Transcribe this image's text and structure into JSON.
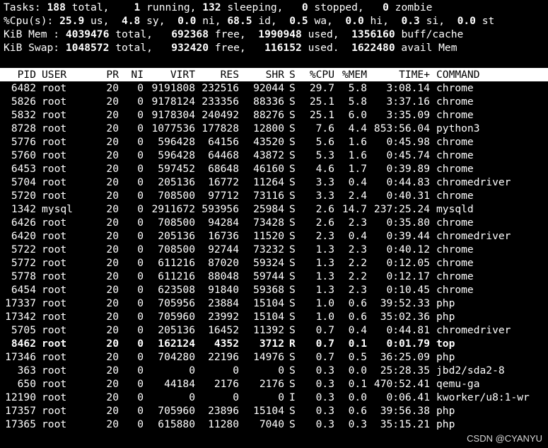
{
  "summary": {
    "tasks": {
      "label": "Tasks:",
      "total": "188",
      "total_label": "total,",
      "running": "1",
      "running_label": "running,",
      "sleeping": "132",
      "sleeping_label": "sleeping,",
      "stopped": "0",
      "stopped_label": "stopped,",
      "zombie": "0",
      "zombie_label": "zombie"
    },
    "cpu": {
      "label": "%Cpu(s):",
      "us": "25.9",
      "us_label": "us,",
      "sy": "4.8",
      "sy_label": "sy,",
      "ni": "0.0",
      "ni_label": "ni,",
      "id": "68.5",
      "id_label": "id,",
      "wa": "0.5",
      "wa_label": "wa,",
      "hi": "0.0",
      "hi_label": "hi,",
      "si": "0.3",
      "si_label": "si,",
      "st": "0.0",
      "st_label": "st"
    },
    "mem": {
      "label": "KiB Mem :",
      "total": "4039476",
      "total_label": "total,",
      "free": "692368",
      "free_label": "free,",
      "used": "1990948",
      "used_label": "used,",
      "buff": "1356160",
      "buff_label": "buff/cache"
    },
    "swap": {
      "label": "KiB Swap:",
      "total": "1048572",
      "total_label": "total,",
      "free": "932420",
      "free_label": "free,",
      "used": "116152",
      "used_label": "used.",
      "avail": "1622480",
      "avail_label": "avail Mem"
    }
  },
  "columns": [
    "PID",
    "USER",
    "PR",
    "NI",
    "VIRT",
    "RES",
    "SHR",
    "S",
    "%CPU",
    "%MEM",
    "TIME+",
    "COMMAND"
  ],
  "processes": [
    {
      "pid": "6482",
      "user": "root",
      "pr": "20",
      "ni": "0",
      "virt": "9191808",
      "res": "232516",
      "shr": "92044",
      "s": "S",
      "cpu": "29.7",
      "mem": "5.8",
      "time": "3:08.14",
      "cmd": "chrome"
    },
    {
      "pid": "5826",
      "user": "root",
      "pr": "20",
      "ni": "0",
      "virt": "9178124",
      "res": "233356",
      "shr": "88336",
      "s": "S",
      "cpu": "25.1",
      "mem": "5.8",
      "time": "3:37.16",
      "cmd": "chrome"
    },
    {
      "pid": "5832",
      "user": "root",
      "pr": "20",
      "ni": "0",
      "virt": "9178304",
      "res": "240492",
      "shr": "88276",
      "s": "S",
      "cpu": "25.1",
      "mem": "6.0",
      "time": "3:35.09",
      "cmd": "chrome"
    },
    {
      "pid": "8728",
      "user": "root",
      "pr": "20",
      "ni": "0",
      "virt": "1077536",
      "res": "177828",
      "shr": "12800",
      "s": "S",
      "cpu": "7.6",
      "mem": "4.4",
      "time": "853:56.04",
      "cmd": "python3"
    },
    {
      "pid": "5776",
      "user": "root",
      "pr": "20",
      "ni": "0",
      "virt": "596428",
      "res": "64156",
      "shr": "43520",
      "s": "S",
      "cpu": "5.6",
      "mem": "1.6",
      "time": "0:45.98",
      "cmd": "chrome"
    },
    {
      "pid": "5760",
      "user": "root",
      "pr": "20",
      "ni": "0",
      "virt": "596428",
      "res": "64468",
      "shr": "43872",
      "s": "S",
      "cpu": "5.3",
      "mem": "1.6",
      "time": "0:45.74",
      "cmd": "chrome"
    },
    {
      "pid": "6453",
      "user": "root",
      "pr": "20",
      "ni": "0",
      "virt": "597452",
      "res": "68648",
      "shr": "46160",
      "s": "S",
      "cpu": "4.6",
      "mem": "1.7",
      "time": "0:39.89",
      "cmd": "chrome"
    },
    {
      "pid": "5704",
      "user": "root",
      "pr": "20",
      "ni": "0",
      "virt": "205136",
      "res": "16772",
      "shr": "11264",
      "s": "S",
      "cpu": "3.3",
      "mem": "0.4",
      "time": "0:44.83",
      "cmd": "chromedriver"
    },
    {
      "pid": "5720",
      "user": "root",
      "pr": "20",
      "ni": "0",
      "virt": "708500",
      "res": "97712",
      "shr": "73116",
      "s": "S",
      "cpu": "3.3",
      "mem": "2.4",
      "time": "0:40.31",
      "cmd": "chrome"
    },
    {
      "pid": "1342",
      "user": "mysql",
      "pr": "20",
      "ni": "0",
      "virt": "2911672",
      "res": "593956",
      "shr": "25984",
      "s": "S",
      "cpu": "2.6",
      "mem": "14.7",
      "time": "237:25.24",
      "cmd": "mysqld"
    },
    {
      "pid": "6426",
      "user": "root",
      "pr": "20",
      "ni": "0",
      "virt": "708500",
      "res": "94284",
      "shr": "73428",
      "s": "S",
      "cpu": "2.6",
      "mem": "2.3",
      "time": "0:35.80",
      "cmd": "chrome"
    },
    {
      "pid": "6420",
      "user": "root",
      "pr": "20",
      "ni": "0",
      "virt": "205136",
      "res": "16736",
      "shr": "11520",
      "s": "S",
      "cpu": "2.3",
      "mem": "0.4",
      "time": "0:39.44",
      "cmd": "chromedriver"
    },
    {
      "pid": "5722",
      "user": "root",
      "pr": "20",
      "ni": "0",
      "virt": "708500",
      "res": "92744",
      "shr": "73232",
      "s": "S",
      "cpu": "1.3",
      "mem": "2.3",
      "time": "0:40.12",
      "cmd": "chrome"
    },
    {
      "pid": "5772",
      "user": "root",
      "pr": "20",
      "ni": "0",
      "virt": "611216",
      "res": "87020",
      "shr": "59324",
      "s": "S",
      "cpu": "1.3",
      "mem": "2.2",
      "time": "0:12.05",
      "cmd": "chrome"
    },
    {
      "pid": "5778",
      "user": "root",
      "pr": "20",
      "ni": "0",
      "virt": "611216",
      "res": "88048",
      "shr": "59744",
      "s": "S",
      "cpu": "1.3",
      "mem": "2.2",
      "time": "0:12.17",
      "cmd": "chrome"
    },
    {
      "pid": "6454",
      "user": "root",
      "pr": "20",
      "ni": "0",
      "virt": "623508",
      "res": "91840",
      "shr": "59368",
      "s": "S",
      "cpu": "1.3",
      "mem": "2.3",
      "time": "0:10.45",
      "cmd": "chrome"
    },
    {
      "pid": "17337",
      "user": "root",
      "pr": "20",
      "ni": "0",
      "virt": "705956",
      "res": "23884",
      "shr": "15104",
      "s": "S",
      "cpu": "1.0",
      "mem": "0.6",
      "time": "39:52.33",
      "cmd": "php"
    },
    {
      "pid": "17342",
      "user": "root",
      "pr": "20",
      "ni": "0",
      "virt": "705960",
      "res": "23992",
      "shr": "15104",
      "s": "S",
      "cpu": "1.0",
      "mem": "0.6",
      "time": "35:02.36",
      "cmd": "php"
    },
    {
      "pid": "5705",
      "user": "root",
      "pr": "20",
      "ni": "0",
      "virt": "205136",
      "res": "16452",
      "shr": "11392",
      "s": "S",
      "cpu": "0.7",
      "mem": "0.4",
      "time": "0:44.81",
      "cmd": "chromedriver"
    },
    {
      "pid": "8462",
      "user": "root",
      "pr": "20",
      "ni": "0",
      "virt": "162124",
      "res": "4352",
      "shr": "3712",
      "s": "R",
      "cpu": "0.7",
      "mem": "0.1",
      "time": "0:01.79",
      "cmd": "top",
      "bold": true
    },
    {
      "pid": "17346",
      "user": "root",
      "pr": "20",
      "ni": "0",
      "virt": "704280",
      "res": "22196",
      "shr": "14976",
      "s": "S",
      "cpu": "0.7",
      "mem": "0.5",
      "time": "36:25.09",
      "cmd": "php"
    },
    {
      "pid": "363",
      "user": "root",
      "pr": "20",
      "ni": "0",
      "virt": "0",
      "res": "0",
      "shr": "0",
      "s": "S",
      "cpu": "0.3",
      "mem": "0.0",
      "time": "25:28.35",
      "cmd": "jbd2/sda2-8"
    },
    {
      "pid": "650",
      "user": "root",
      "pr": "20",
      "ni": "0",
      "virt": "44184",
      "res": "2176",
      "shr": "2176",
      "s": "S",
      "cpu": "0.3",
      "mem": "0.1",
      "time": "470:52.41",
      "cmd": "qemu-ga"
    },
    {
      "pid": "12190",
      "user": "root",
      "pr": "20",
      "ni": "0",
      "virt": "0",
      "res": "0",
      "shr": "0",
      "s": "I",
      "cpu": "0.3",
      "mem": "0.0",
      "time": "0:06.41",
      "cmd": "kworker/u8:1-wr"
    },
    {
      "pid": "17357",
      "user": "root",
      "pr": "20",
      "ni": "0",
      "virt": "705960",
      "res": "23896",
      "shr": "15104",
      "s": "S",
      "cpu": "0.3",
      "mem": "0.6",
      "time": "39:56.38",
      "cmd": "php"
    },
    {
      "pid": "17365",
      "user": "root",
      "pr": "20",
      "ni": "0",
      "virt": "615880",
      "res": "11280",
      "shr": "7040",
      "s": "S",
      "cpu": "0.3",
      "mem": "0.3",
      "time": "35:15.21",
      "cmd": "php"
    }
  ],
  "watermark": "CSDN @CYANYU",
  "colors": {
    "background": "#000000",
    "text": "#ffffff",
    "header_bg": "#ffffff",
    "header_text": "#000000"
  }
}
